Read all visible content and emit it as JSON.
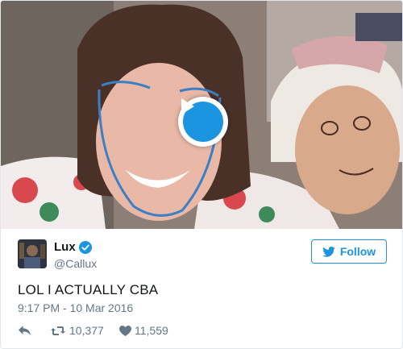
{
  "tweet": {
    "author": {
      "display_name": "Lux",
      "handle": "@Callux",
      "verified": true
    },
    "follow_label": "Follow",
    "text": "LOL I ACTUALLY CBA",
    "timestamp": "9:17 PM - 10 Mar 2016",
    "retweet_count": "10,377",
    "like_count": "11,559",
    "media": {
      "type": "video",
      "play_icon": "play-icon"
    }
  },
  "colors": {
    "accent": "#1b95e0",
    "text": "#14171a",
    "muted": "#657786",
    "border": "#e1e8ed"
  }
}
